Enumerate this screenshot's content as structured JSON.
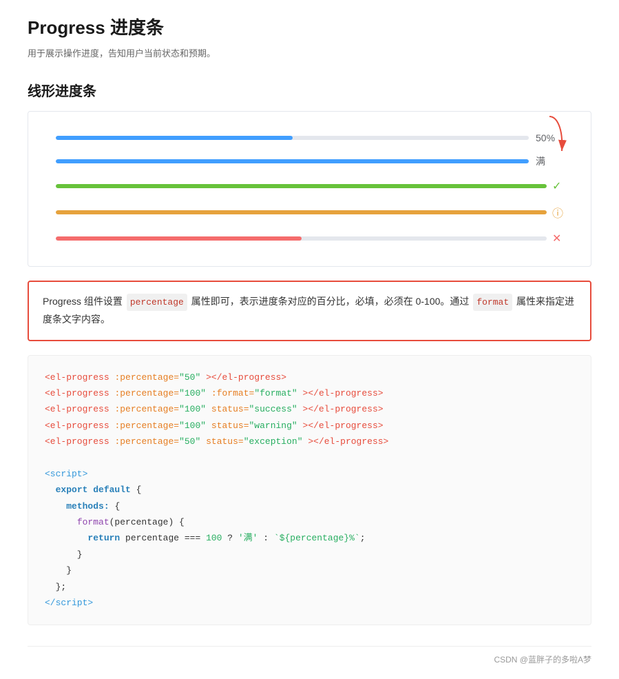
{
  "header": {
    "title": "Progress 进度条",
    "desc": "用于展示操作进度，告知用户当前状态和预期。"
  },
  "section": {
    "linear_title": "线形进度条"
  },
  "progress_bars": [
    {
      "id": "bar1",
      "percent": 50,
      "color": "#409eff",
      "show_text": "50%",
      "has_icon": false
    },
    {
      "id": "bar2",
      "percent": 100,
      "color": "#409eff",
      "show_text": "满",
      "has_icon": false
    },
    {
      "id": "bar3",
      "percent": 100,
      "color": "#67c23a",
      "has_icon": true,
      "icon": "✓",
      "icon_color": "#67c23a",
      "show_text": ""
    },
    {
      "id": "bar4",
      "percent": 100,
      "color": "#e6a23c",
      "has_icon": true,
      "icon": "ℹ",
      "icon_color": "#e6a23c",
      "show_text": ""
    },
    {
      "id": "bar5",
      "percent": 50,
      "color": "#f56c6c",
      "has_icon": true,
      "icon": "✕",
      "icon_color": "#f56c6c",
      "show_text": ""
    }
  ],
  "info_box": {
    "text_before_tag1": "Progress 组件设置 ",
    "tag1": "percentage",
    "text_mid1": " 属性即可，表示进度条对应的百分比，必填，必须在 0-100。通过 ",
    "tag2": "format",
    "text_after": " 属性来指定进度条文字内容。"
  },
  "code": {
    "lines": [
      {
        "type": "html",
        "content": "<el-progress :percentage=\"50\"></el-progress>"
      },
      {
        "type": "html",
        "content": "<el-progress :percentage=\"100\" :format=\"format\"></el-progress>"
      },
      {
        "type": "html",
        "content": "<el-progress :percentage=\"100\" status=\"success\"></el-progress>"
      },
      {
        "type": "html",
        "content": "<el-progress :percentage=\"100\" status=\"warning\"></el-progress>"
      },
      {
        "type": "html",
        "content": "<el-progress :percentage=\"50\" status=\"exception\"></el-progress>"
      }
    ],
    "script_lines": [
      "<script>",
      "  export default {",
      "    methods: {",
      "      format(percentage) {",
      "        return percentage === 100 ? '满' : `${percentage}%`;",
      "      }",
      "    }",
      "  };",
      "</script>"
    ]
  },
  "footer": {
    "text": "CSDN @蓝胖子的多啦A梦"
  }
}
